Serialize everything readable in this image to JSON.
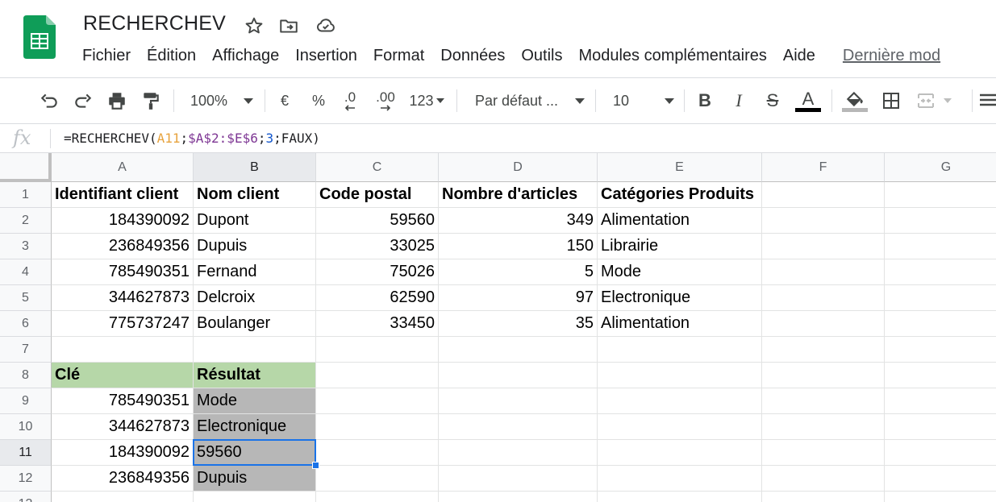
{
  "document": {
    "title": "RECHERCHEV",
    "star_icon": "star-icon",
    "move_icon": "move-to-folder-icon",
    "cloud_icon": "cloud-saved-icon"
  },
  "menu": {
    "items": [
      "Fichier",
      "Édition",
      "Affichage",
      "Insertion",
      "Format",
      "Données",
      "Outils",
      "Modules complémentaires",
      "Aide"
    ],
    "last_edit": "Dernière mod"
  },
  "toolbar": {
    "zoom": "100%",
    "currency": "€",
    "percent": "%",
    "decrease_decimals": ".0",
    "increase_decimals": ".00",
    "more_formats": "123",
    "font": "Par défaut ...",
    "font_size": "10",
    "bold": "B",
    "italic": "I",
    "strike": "S",
    "text_color": "A",
    "text_color_value": "#000000",
    "fill_color_value": "#b7b7b7"
  },
  "formula_bar": {
    "fx": "fx",
    "parts": {
      "p1": "=RECHERCHEV(",
      "ref1": "A11",
      "sep1": ";",
      "ref2": "$A$2:$E$6",
      "sep2": ";",
      "num": "3",
      "p2": ";FAUX)"
    }
  },
  "grid": {
    "columns": [
      "A",
      "B",
      "C",
      "D",
      "E",
      "F",
      "G"
    ],
    "rows": [
      "1",
      "2",
      "3",
      "4",
      "5",
      "6",
      "7",
      "8",
      "9",
      "10",
      "11",
      "12",
      "13"
    ],
    "header_row": [
      "Identifiant client",
      "Nom client",
      "Code postal",
      "Nombre d'articles",
      "Catégories Produits"
    ],
    "data": [
      [
        "184390092",
        "Dupont",
        "59560",
        "349",
        "Alimentation"
      ],
      [
        "236849356",
        "Dupuis",
        "33025",
        "150",
        "Librairie"
      ],
      [
        "785490351",
        "Fernand",
        "75026",
        "5",
        "Mode"
      ],
      [
        "344627873",
        "Delcroix",
        "62590",
        "97",
        "Electronique"
      ],
      [
        "775737247",
        "Boulanger",
        "33450",
        "35",
        "Alimentation"
      ]
    ],
    "lookup_header": [
      "Clé",
      "Résultat"
    ],
    "lookup": [
      [
        "785490351",
        "Mode"
      ],
      [
        "344627873",
        "Electronique"
      ],
      [
        "184390092",
        "59560"
      ],
      [
        "236849356",
        "Dupuis"
      ]
    ],
    "selected_cell": "B11",
    "colors": {
      "header_green": "#b6d7a8",
      "result_gray": "#b7b7b7",
      "selection_blue": "#1a73e8"
    }
  }
}
